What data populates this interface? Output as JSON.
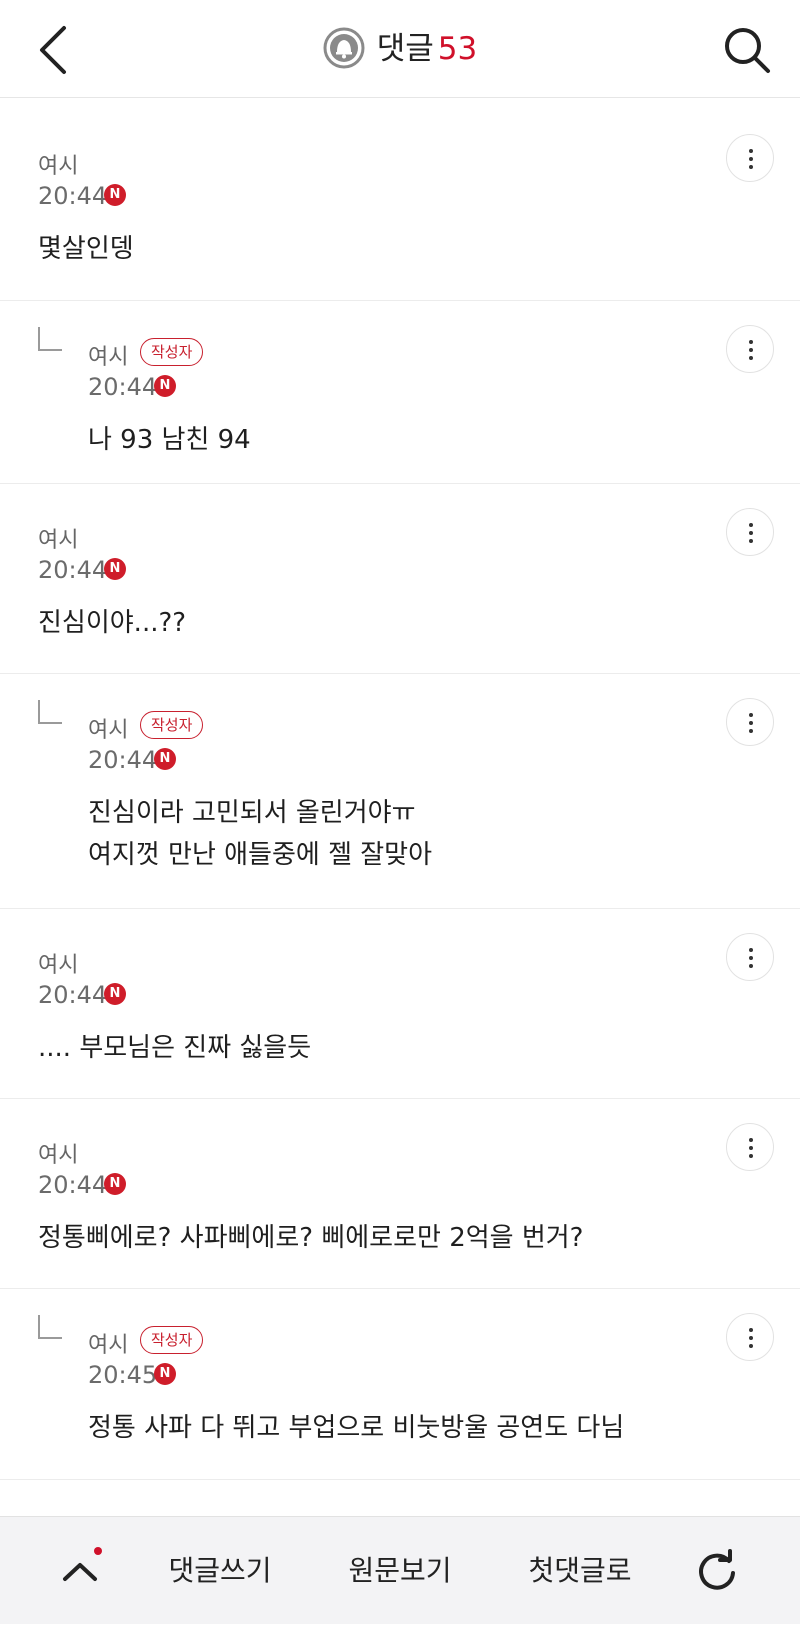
{
  "header": {
    "title": "댓글",
    "count": "53"
  },
  "comments": [
    {
      "author": "여시",
      "time": "20:44",
      "badge": "N",
      "body": "몇살인뎅"
    },
    {
      "author": "여시",
      "op_label": "작성자",
      "time": "20:44",
      "badge": "N",
      "body": "나 93 남친 94"
    },
    {
      "author": "여시",
      "time": "20:44",
      "badge": "N",
      "body": "진심이야...??"
    },
    {
      "author": "여시",
      "op_label": "작성자",
      "time": "20:44",
      "badge": "N",
      "body_line1": "진심이라 고민되서 올린거야ㅠ",
      "body_line2": "여지껏 만난 애들중에 젤 잘맞아"
    },
    {
      "author": "여시",
      "time": "20:44",
      "badge": "N",
      "body": ".... 부모님은 진짜 싫을듯"
    },
    {
      "author": "여시",
      "time": "20:44",
      "badge": "N",
      "body": "정통삐에로? 사파삐에로? 삐에로로만 2억을 번거?"
    },
    {
      "author": "여시",
      "op_label": "작성자",
      "time": "20:45",
      "badge": "N",
      "body": "정통 사파 다 뛰고 부업으로 비눗방울 공연도 다님"
    }
  ],
  "bottom_bar": {
    "write_label": "댓글쓰기",
    "original_label": "원문보기",
    "first_label": "첫댓글로"
  },
  "colors": {
    "accent": "#d0102a",
    "divider": "#ececec",
    "bottom_bg": "#f3f3f5"
  },
  "icons": [
    "back-arrow-icon",
    "bell-icon",
    "search-icon",
    "more-vertical-icon",
    "reply-indent-icon",
    "chevron-up-icon",
    "refresh-icon"
  ]
}
